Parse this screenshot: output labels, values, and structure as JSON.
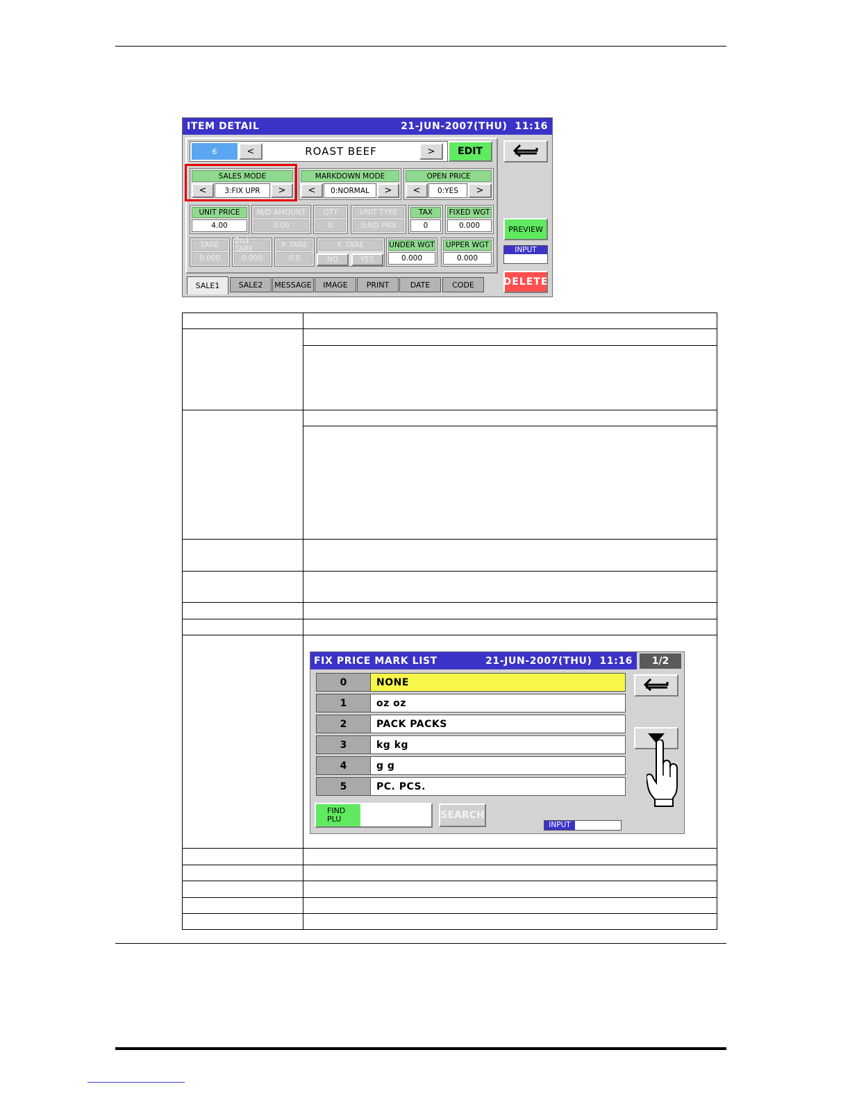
{
  "item_detail": {
    "title": "ITEM DETAIL",
    "datetime": "21-JUN-2007(THU)  11:16",
    "plu_number": "6",
    "prev_symbol": "<",
    "next_symbol": ">",
    "item_name": "ROAST BEEF",
    "edit_label": "EDIT",
    "return_icon": "return-arrow-icon",
    "sales_mode": {
      "label": "SALES MODE",
      "value": "3:FIX UPR"
    },
    "markdown_mode": {
      "label": "MARKDOWN MODE",
      "value": "0:NORMAL"
    },
    "open_price": {
      "label": "OPEN PRICE",
      "value": "0:YES"
    },
    "fields_row1": [
      {
        "label": "UNIT PRICE",
        "value": "4.00",
        "enabled": true
      },
      {
        "label": "M/D AMOUNT",
        "value": "0.00",
        "enabled": false
      },
      {
        "label": "QTY",
        "value": "0",
        "enabled": false
      },
      {
        "label": "UNIT TYPE",
        "value": "0:NO PRN",
        "enabled": false
      },
      {
        "label": "TAX",
        "value": "0",
        "enabled": true
      },
      {
        "label": "FIXED WGT",
        "value": "0.000",
        "enabled": true
      }
    ],
    "fields_row2": [
      {
        "label": "TARE",
        "value": "0.000",
        "enabled": false
      },
      {
        "label": "2nd TARE",
        "value": "0.000",
        "enabled": false
      },
      {
        "label": "P. TARE",
        "value": "0.0",
        "enabled": false
      },
      {
        "label": "F. TARE",
        "value": "",
        "enabled": false
      },
      {
        "label": "UNDER WGT",
        "value": "0.000",
        "enabled": true
      },
      {
        "label": "UPPER WGT",
        "value": "0.000",
        "enabled": true
      }
    ],
    "ftare_options": [
      "NO",
      "YES"
    ],
    "preview_label": "PREVIEW",
    "input_label": "INPUT",
    "delete_label": "DELETE",
    "tabs": [
      "SALE1",
      "SALE2",
      "MESSAGE",
      "IMAGE",
      "PRINT",
      "DATE",
      "CODE"
    ],
    "accent": "#3b33c8",
    "highlight_color": "#e60000"
  },
  "fix_price_list": {
    "title": "FIX PRICE MARK LIST",
    "datetime": "21-JUN-2007(THU)  11:16",
    "page": "1/2",
    "rows": [
      {
        "num": "0",
        "text": "NONE",
        "selected": true
      },
      {
        "num": "1",
        "text": "oz oz",
        "selected": false
      },
      {
        "num": "2",
        "text": "PACK PACKS",
        "selected": false
      },
      {
        "num": "3",
        "text": "kg kg",
        "selected": false
      },
      {
        "num": "4",
        "text": "g g",
        "selected": false
      },
      {
        "num": "5",
        "text": "PC. PCS.",
        "selected": false
      }
    ],
    "find_plu_label": "FIND PLU",
    "search_label": "SEARCH",
    "input_label": "INPUT",
    "selected_color": "#f7f74a"
  }
}
